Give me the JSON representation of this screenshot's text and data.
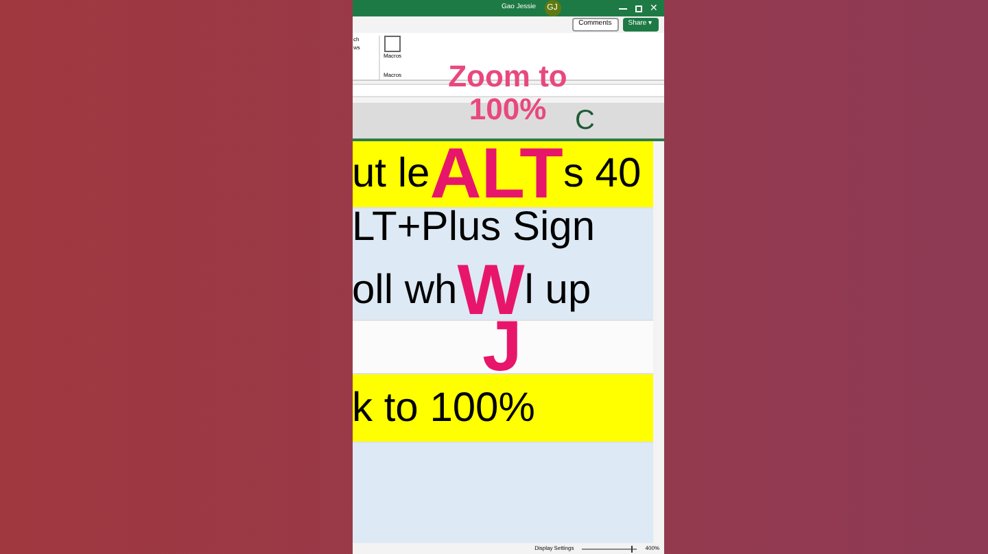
{
  "title_bar": {
    "user": "Gao Jessie",
    "avatar": "GJ",
    "close": "✕"
  },
  "ribbon": {
    "buttons": [
      {
        "label": "Comments"
      },
      {
        "label": "Share",
        "caret": "▾"
      }
    ],
    "group_left": "ch",
    "group_left_sub": "ws",
    "macros": "Macros",
    "macros_group": "Macros"
  },
  "caption": [
    "Zoom to",
    "100%"
  ],
  "column_header": "C",
  "rows": [
    {
      "kind": "yellow",
      "lines": [
        [
          {
            "kind": "text",
            "text": "ut le"
          },
          {
            "kind": "key",
            "text": "ALT"
          },
          {
            "kind": "text",
            "text": "s 40"
          }
        ]
      ]
    },
    {
      "kind": "blue",
      "lines": [
        [
          {
            "kind": "text",
            "text": "LT+Plus Sign"
          }
        ],
        [
          {
            "kind": "text",
            "text": "oll wh"
          },
          {
            "kind": "key",
            "text": "W"
          },
          {
            "kind": "text",
            "text": "l up"
          }
        ]
      ]
    },
    {
      "kind": "white",
      "lines": [
        [
          {
            "kind": "key",
            "text": "J"
          }
        ]
      ]
    },
    {
      "kind": "yellow",
      "lines": [
        [
          {
            "kind": "text",
            "text": "k to 100%"
          }
        ]
      ]
    },
    {
      "kind": "blue",
      "lines": []
    }
  ],
  "status_bar": {
    "display_settings": "Display Settings",
    "zoom": "400%",
    "level": 0.9
  }
}
